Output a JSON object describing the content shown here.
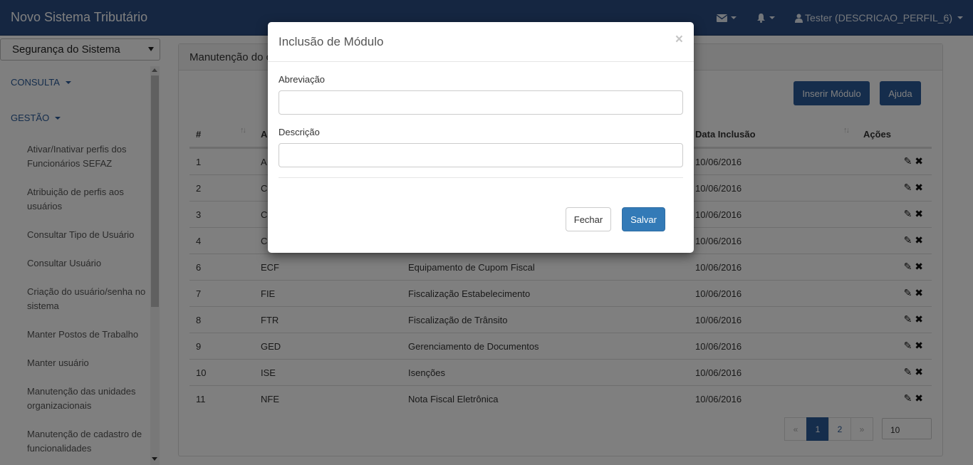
{
  "app": {
    "title": "Novo Sistema Tributário"
  },
  "navbar": {
    "mail_icon": "envelope-icon",
    "bell_icon": "bell-icon",
    "user_icon": "user-icon",
    "user_label": "Tester (DESCRICAO_PERFIL_6)"
  },
  "sidebar": {
    "module_select": "Segurança do Sistema",
    "sections": [
      "CONSULTA",
      "GESTÃO"
    ],
    "items": [
      "Ativar/Inativar perfis dos Funcionários SEFAZ",
      "Atribuição de perfis aos usuários",
      "Consultar Tipo de Usuário",
      "Consultar Usuário",
      "Criação do usuário/senha no sistema",
      "Manter Postos de Trabalho",
      "Manter usuário",
      "Manutenção das unidades organizacionais",
      "Manutenção de cadastro de funcionalidades"
    ]
  },
  "panel": {
    "title": "Manutenção do c",
    "insert_button": "Inserir Módulo",
    "help_button": "Ajuda"
  },
  "table": {
    "headers": {
      "num": "#",
      "abbr": "A",
      "date": "Data Inclusão",
      "actions": "Ações"
    },
    "rows": [
      {
        "num": "1",
        "abbr": "A",
        "desc": "",
        "date": "10/06/2016"
      },
      {
        "num": "2",
        "abbr": "C",
        "desc": "",
        "date": "10/06/2016"
      },
      {
        "num": "3",
        "abbr": "C",
        "desc": "",
        "date": "10/06/2016"
      },
      {
        "num": "4",
        "abbr": "C",
        "desc": "",
        "date": "10/06/2016"
      },
      {
        "num": "6",
        "abbr": "ECF",
        "desc": "Equipamento de Cupom Fiscal",
        "date": "10/06/2016"
      },
      {
        "num": "7",
        "abbr": "FIE",
        "desc": "Fiscalização Estabelecimento",
        "date": "10/06/2016"
      },
      {
        "num": "8",
        "abbr": "FTR",
        "desc": "Fiscalização de Trânsito",
        "date": "10/06/2016"
      },
      {
        "num": "9",
        "abbr": "GED",
        "desc": "Gerenciamento de Documentos",
        "date": "10/06/2016"
      },
      {
        "num": "10",
        "abbr": "ISE",
        "desc": "Isenções",
        "date": "10/06/2016"
      },
      {
        "num": "11",
        "abbr": "NFE",
        "desc": "Nota Fiscal Eletrônica",
        "date": "10/06/2016"
      }
    ]
  },
  "pagination": {
    "prev": "«",
    "pages": [
      "1",
      "2"
    ],
    "next": "»",
    "active_page": "1",
    "page_size": "10"
  },
  "modal": {
    "title": "Inclusão de Módulo",
    "close": "×",
    "abbr_label": "Abreviação",
    "abbr_value": "",
    "desc_label": "Descrição",
    "desc_value": "",
    "close_button": "Fechar",
    "save_button": "Salvar"
  },
  "colors": {
    "navbar": "#2a4d82",
    "accent": "#2a5a99",
    "save": "#337ab7"
  }
}
